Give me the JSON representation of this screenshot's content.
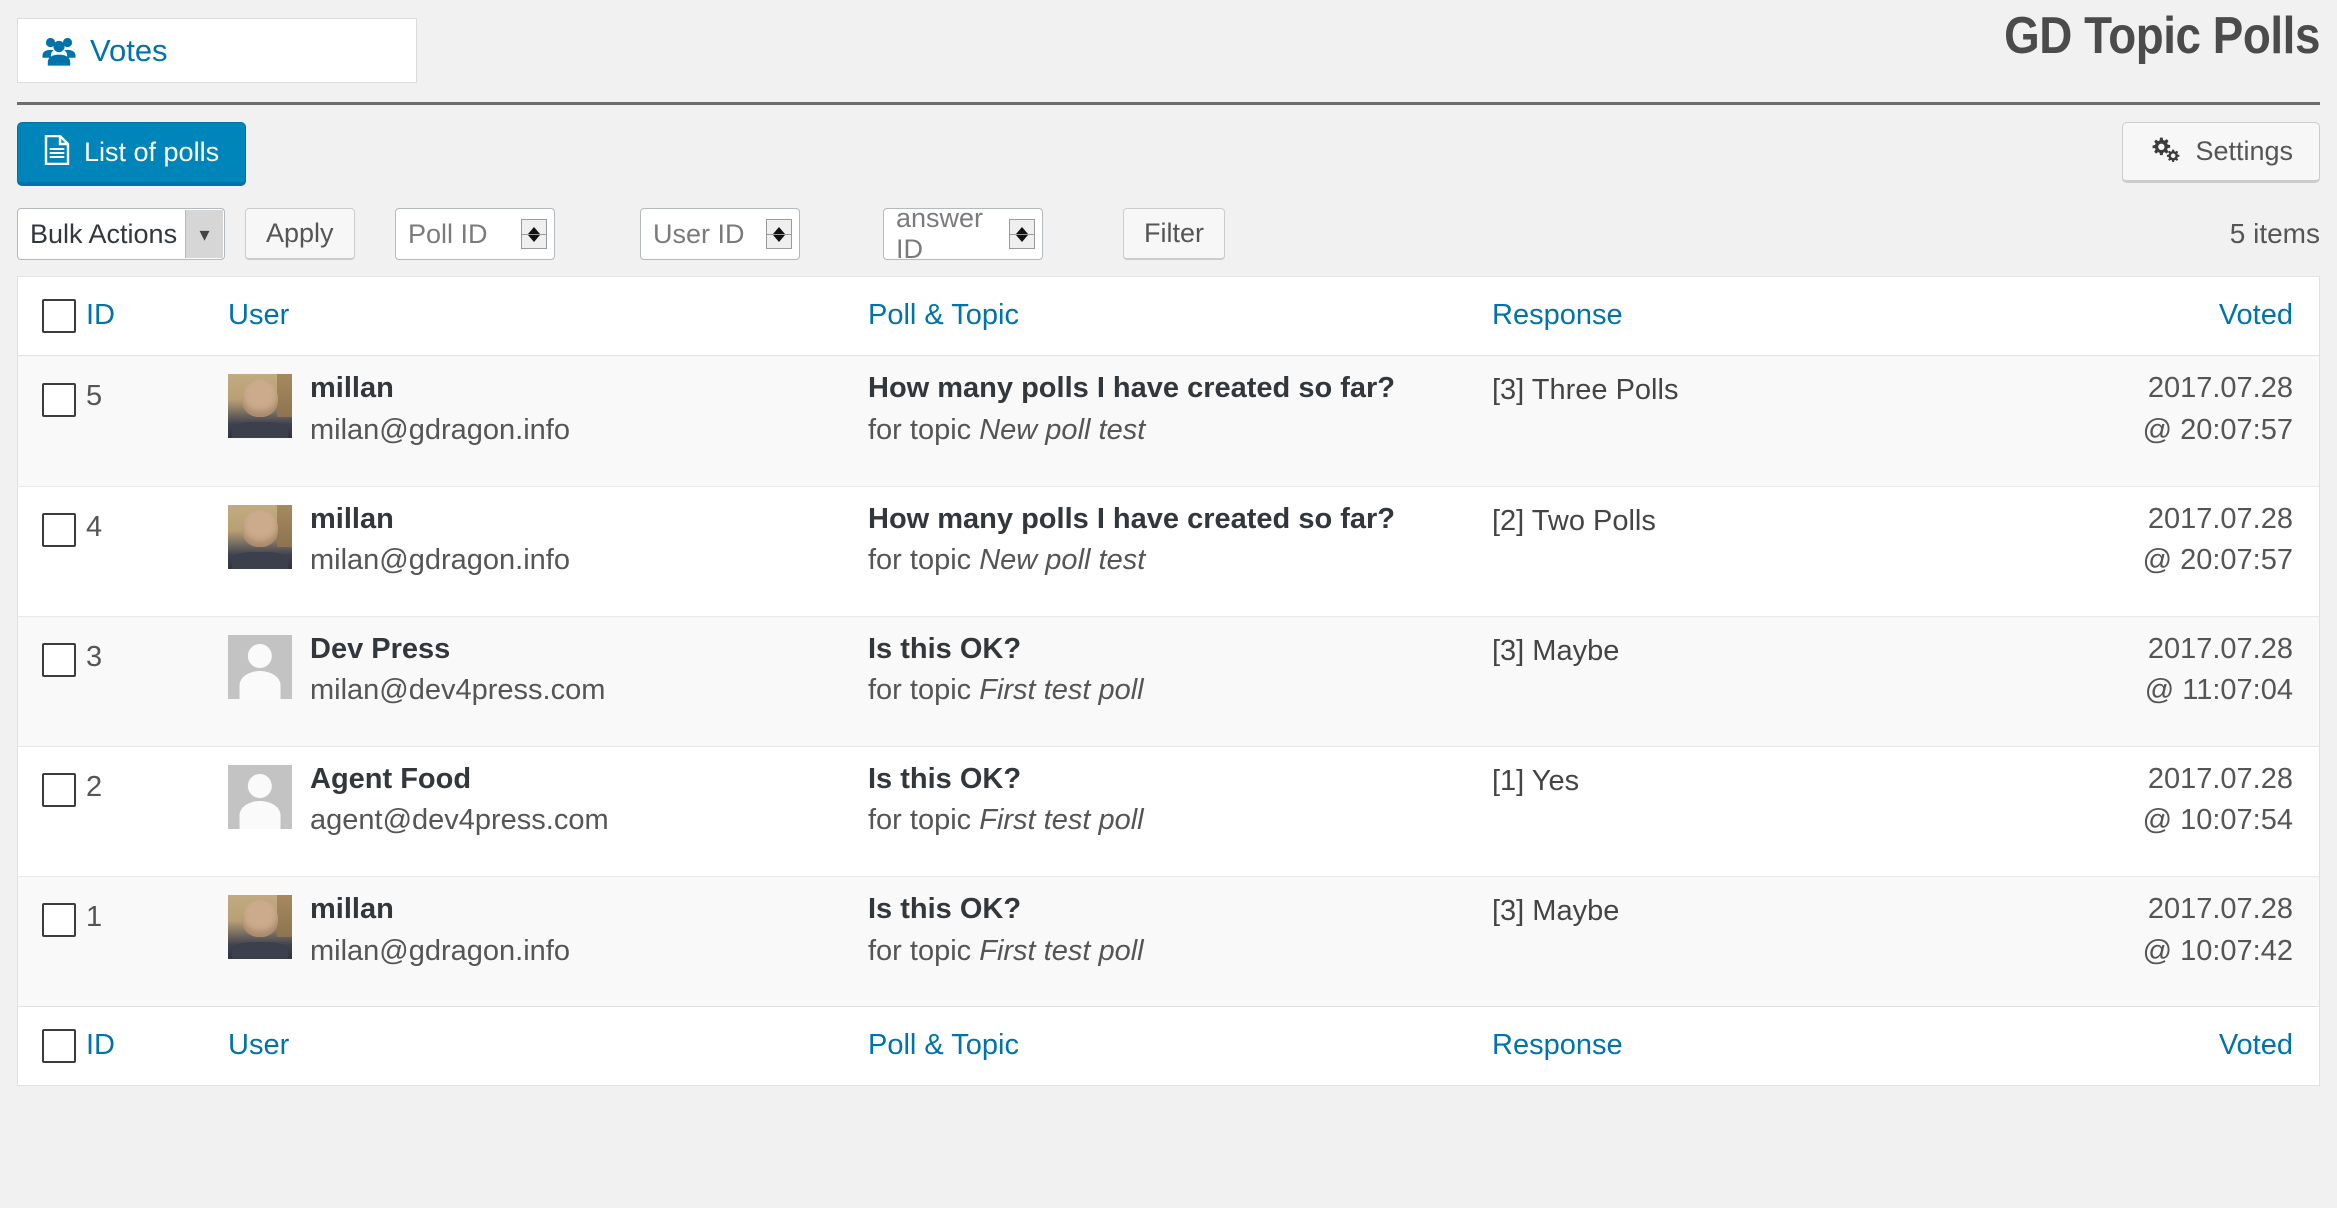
{
  "header": {
    "tabs": [
      {
        "label": "Votes",
        "icon": "users-group-icon"
      }
    ],
    "brand_title": "GD Topic Polls"
  },
  "toolbar": {
    "primary_button": {
      "label": "List of polls",
      "icon": "document-icon"
    },
    "secondary_button": {
      "label": "Settings",
      "icon": "gears-icon"
    }
  },
  "filters": {
    "bulk_actions_selected": "Bulk Actions",
    "apply_label": "Apply",
    "poll_id_placeholder": "Poll ID",
    "user_id_placeholder": "User ID",
    "answer_id_placeholder": "answer ID",
    "filter_label": "Filter",
    "items_count": "5 items"
  },
  "table": {
    "columns": {
      "id": "ID",
      "user": "User",
      "poll": "Poll & Topic",
      "response": "Response",
      "voted": "Voted"
    },
    "for_topic_prefix": "for topic",
    "rows": [
      {
        "id": "5",
        "user_name": "millan",
        "user_email": "milan@gdragon.info",
        "avatar_type": "photo",
        "poll_title": "How many polls I have created so far?",
        "topic": "New poll test",
        "response": "[3] Three Polls",
        "voted_date": "2017.07.28",
        "voted_time": "@ 20:07:57"
      },
      {
        "id": "4",
        "user_name": "millan",
        "user_email": "milan@gdragon.info",
        "avatar_type": "photo",
        "poll_title": "How many polls I have created so far?",
        "topic": "New poll test",
        "response": "[2] Two Polls",
        "voted_date": "2017.07.28",
        "voted_time": "@ 20:07:57"
      },
      {
        "id": "3",
        "user_name": "Dev Press",
        "user_email": "milan@dev4press.com",
        "avatar_type": "default",
        "poll_title": "Is this OK?",
        "topic": "First test poll",
        "response": "[3] Maybe",
        "voted_date": "2017.07.28",
        "voted_time": "@ 11:07:04"
      },
      {
        "id": "2",
        "user_name": "Agent Food",
        "user_email": "agent@dev4press.com",
        "avatar_type": "default",
        "poll_title": "Is this OK?",
        "topic": "First test poll",
        "response": "[1] Yes",
        "voted_date": "2017.07.28",
        "voted_time": "@ 10:07:54"
      },
      {
        "id": "1",
        "user_name": "millan",
        "user_email": "milan@gdragon.info",
        "avatar_type": "photo",
        "poll_title": "Is this OK?",
        "topic": "First test poll",
        "response": "[3] Maybe",
        "voted_date": "2017.07.28",
        "voted_time": "@ 10:07:42"
      }
    ]
  },
  "colors": {
    "accent_blue": "#0073aa",
    "button_blue": "#0085ba",
    "page_bg": "#f1f1f1",
    "alt_row": "#f9f9f9",
    "title_gray": "#4b4b4b"
  }
}
